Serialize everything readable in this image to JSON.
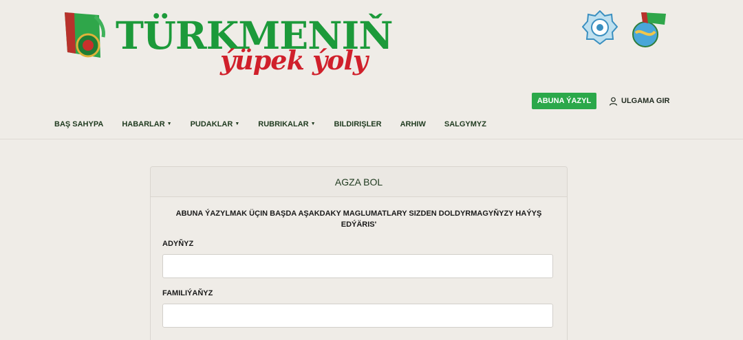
{
  "header": {
    "logo_title": "TÜRKMENIŇ",
    "logo_subtitle": "ýüpek ýoly",
    "logo_icon": "turkmen-flag-emblem",
    "emblems": [
      "national-emblem-badge-icon",
      "globe-flag-emblem-icon"
    ]
  },
  "actions": {
    "subscribe_label": "ABUNA ÝAZYL",
    "login_label": "ULGAMA GIR",
    "login_icon": "user-icon"
  },
  "nav": {
    "items": [
      {
        "label": "BAŞ SAHYPA",
        "dropdown": false
      },
      {
        "label": "HABARLAR",
        "dropdown": true
      },
      {
        "label": "PUDAKLAR",
        "dropdown": true
      },
      {
        "label": "RUBRIKALAR",
        "dropdown": true
      },
      {
        "label": "BILDIRIŞLER",
        "dropdown": false
      },
      {
        "label": "ARHIW",
        "dropdown": false
      },
      {
        "label": "SALGYMYZ",
        "dropdown": false
      }
    ]
  },
  "form": {
    "title": "AGZA BOL",
    "intro": "ABUNA ÝAZYLMAK ÜÇIN BAŞDA AŞAKDAKY MAGLUMATLARY SIZDEN DOLDYRMAGYŇYZY HAÝYŞ EDÝÄRIS'",
    "fields": [
      {
        "label": "ADYŇYZ",
        "value": "",
        "placeholder": ""
      },
      {
        "label": "FAMILIÝAŇYZ",
        "value": "",
        "placeholder": ""
      }
    ]
  },
  "colors": {
    "brand_green": "#1c9a3a",
    "brand_red": "#d0202b",
    "button_green": "#2ba84a",
    "background": "#efece7"
  }
}
